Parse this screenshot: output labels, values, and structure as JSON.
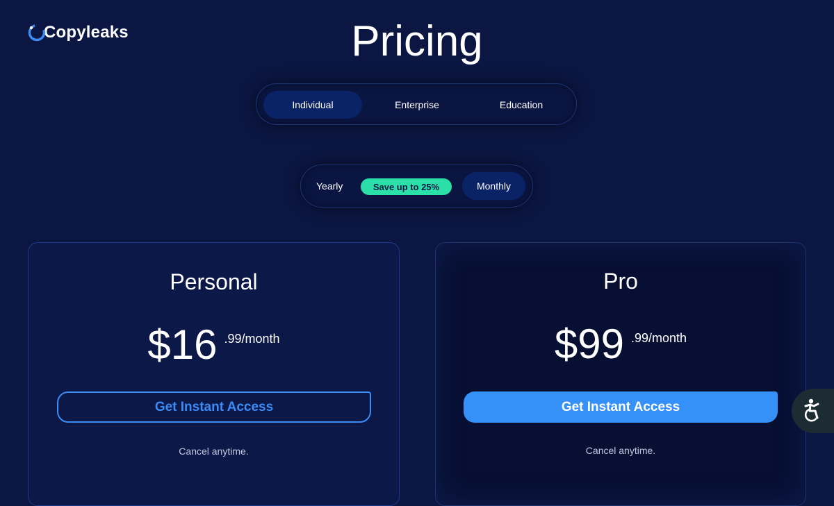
{
  "header": {
    "logo_text": "Copyleaks",
    "title": "Pricing"
  },
  "audience_tabs": [
    {
      "label": "Individual",
      "active": true
    },
    {
      "label": "Enterprise",
      "active": false
    },
    {
      "label": "Education",
      "active": false
    }
  ],
  "billing": {
    "yearly_label": "Yearly",
    "save_badge": "Save up to 25%",
    "monthly_label": "Monthly",
    "selected": "Monthly"
  },
  "plans": [
    {
      "name": "Personal",
      "price_main": "$16",
      "price_suffix": ".99/month",
      "cta": "Get Instant Access",
      "note": "Cancel anytime."
    },
    {
      "name": "Pro",
      "price_main": "$99",
      "price_suffix": ".99/month",
      "cta": "Get Instant Access",
      "note": "Cancel anytime."
    }
  ],
  "accessibility": {
    "icon": "accessibility-icon"
  },
  "colors": {
    "background": "#0b1642",
    "accent": "#3590f8",
    "badge": "#2be0a8",
    "active_tab": "#0a2266"
  }
}
